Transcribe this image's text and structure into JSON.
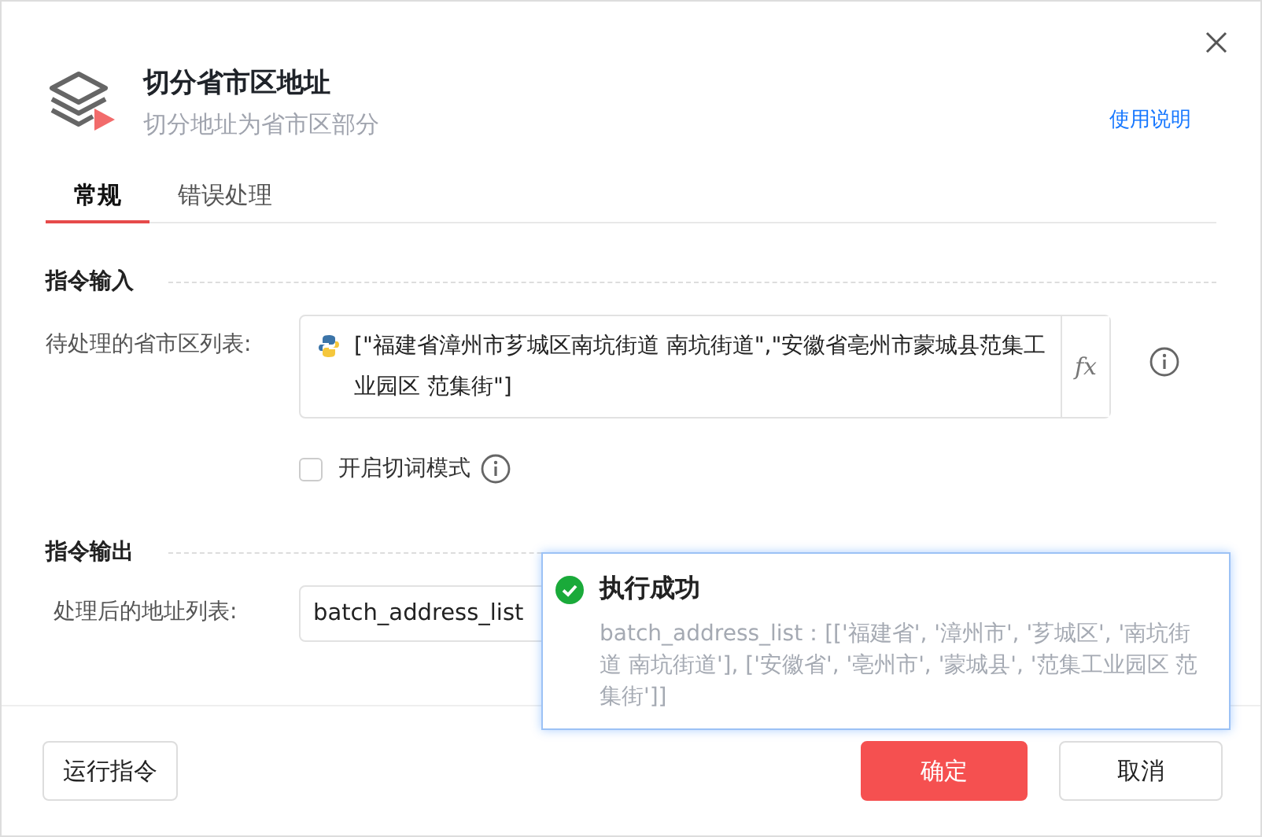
{
  "header": {
    "title": "切分省市区地址",
    "subtitle": "切分地址为省市区部分",
    "help_link": "使用说明"
  },
  "tabs": [
    {
      "label": "常规",
      "selected": true
    },
    {
      "label": "错误处理",
      "selected": false
    }
  ],
  "input_section": {
    "title": "指令输入",
    "field_label": "待处理的省市区列表:",
    "field_value": "[\"福建省漳州市芗城区南坑街道 南坑街道\",\"安徽省亳州市蒙城县范集工业园区 范集街\"]",
    "fx_label": "𝑓x",
    "checkbox": {
      "label": "开启切词模式",
      "checked": false
    }
  },
  "output_section": {
    "title": "指令输出",
    "field_label": "处理后的地址列表:",
    "field_value": "batch_address_list"
  },
  "toast": {
    "title": "执行成功",
    "message": "batch_address_list：[['福建省', '漳州市', '芗城区', '南坑街道 南坑街道'], ['安徽省', '亳州市', '蒙城县', '范集工业园区 范集街']]"
  },
  "buttons": {
    "run": "运行指令",
    "ok": "确定",
    "cancel": "取消"
  }
}
